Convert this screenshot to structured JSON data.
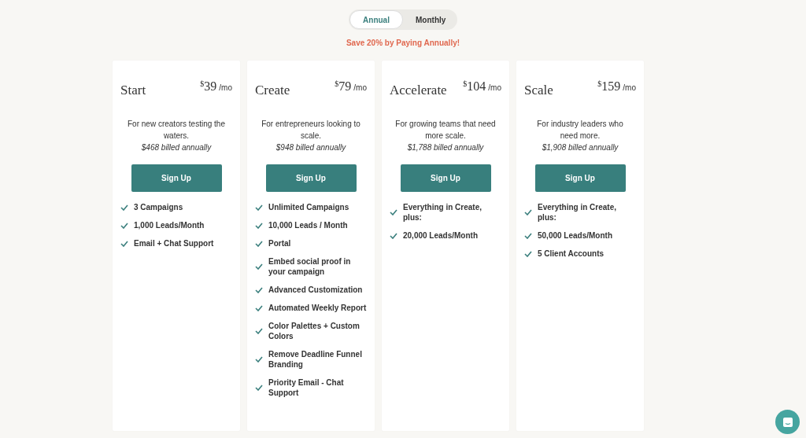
{
  "billing_toggle": [
    {
      "label": "Annual",
      "selected": true
    },
    {
      "label": "Monthly",
      "selected": false
    }
  ],
  "promo": "Save 20% by Paying Annually!",
  "plans": [
    {
      "name": "Start",
      "currency": "$",
      "price": "39",
      "period": "/mo",
      "description": "For new creators testing the waters.",
      "billed": "$468 billed annually",
      "button": "Sign Up",
      "features": [
        "3 Campaigns",
        "1,000 Leads/Month",
        "Email + Chat Support"
      ]
    },
    {
      "name": "Create",
      "currency": "$",
      "price": "79",
      "period": "/mo",
      "description": "For entrepreneurs looking to scale.",
      "billed": "$948 billed annually",
      "button": "Sign Up",
      "features": [
        "Unlimited Campaigns",
        "10,000 Leads / Month",
        "Portal",
        "Embed social proof in your campaign",
        "Advanced Customization",
        "Automated Weekly Report",
        "Color Palettes + Custom Colors",
        "Remove Deadline Funnel Branding",
        "Priority Email - Chat Support"
      ]
    },
    {
      "name": "Accelerate",
      "currency": "$",
      "price": "104",
      "period": "/mo",
      "description": "For growing teams that need more scale.",
      "billed": "$1,788 billed annually",
      "button": "Sign Up",
      "features": [
        "Everything in Create, plus:",
        "20,000 Leads/Month"
      ]
    },
    {
      "name": "Scale",
      "currency": "$",
      "price": "159",
      "period": "/mo",
      "description": "For industry leaders who need more.",
      "billed": "$1,908 billed annually",
      "button": "Sign Up",
      "features": [
        "Everything in Create, plus:",
        "50,000 Leads/Month",
        "5 Client Accounts"
      ]
    }
  ]
}
